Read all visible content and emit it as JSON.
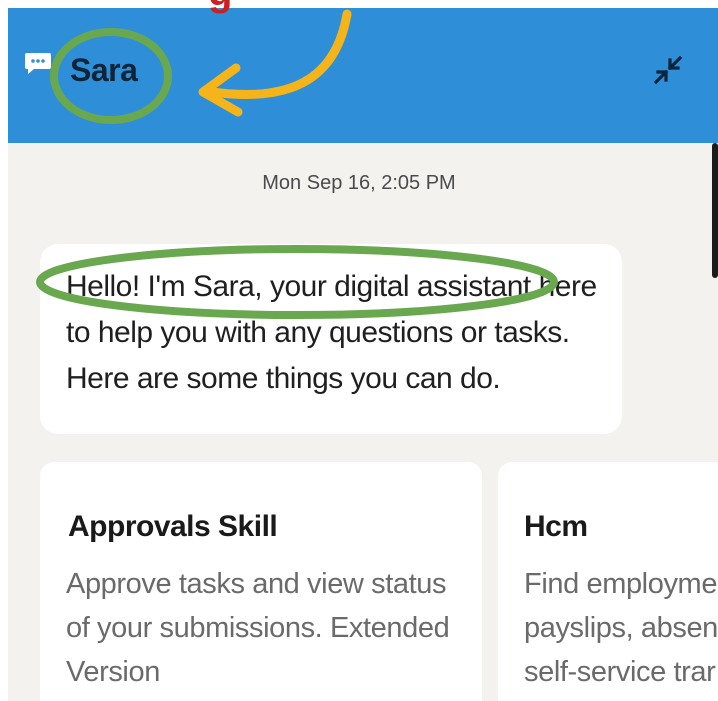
{
  "annotation": {
    "caption": "g",
    "colors": {
      "circle": "#6aa84f",
      "arrow": "#f4b41a",
      "caption": "#cc1f1f"
    }
  },
  "header": {
    "bot_name": "Sara",
    "chat_icon": "chat-bubble-icon",
    "minimize_icon": "minimize-arrows-icon",
    "background": "#2e8fd8"
  },
  "conversation": {
    "timestamp": "Mon Sep 16, 2:05 PM",
    "greeting": "Hello! I'm Sara, your digital assistant here to help you with any questions or tasks. Here are some things you can do."
  },
  "skills": [
    {
      "title": "Approvals Skill",
      "description": "Approve tasks and view status of your submissions. Extended Version"
    },
    {
      "title": "Hcm",
      "description_lines": [
        "Find employme",
        "payslips, absen",
        "self-service trar"
      ]
    }
  ]
}
